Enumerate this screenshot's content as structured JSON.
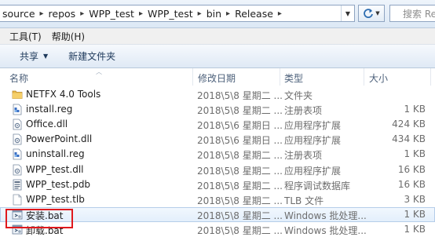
{
  "address": {
    "crumbs": [
      "source",
      "repos",
      "WPP_test",
      "WPP_test",
      "bin",
      "Release"
    ],
    "separator": "▸"
  },
  "search": {
    "placeholder": "搜索 Relea"
  },
  "menu": {
    "tools": "工具(T)",
    "help": "帮助(H)"
  },
  "toolbar": {
    "share": "共享",
    "new_folder": "新建文件夹"
  },
  "columns": {
    "name": "名称",
    "modified": "修改日期",
    "type": "类型",
    "size": "大小"
  },
  "files": [
    {
      "name": "NETFX 4.0 Tools",
      "date": "2018\\5\\8 星期二 ...",
      "type": "文件夹",
      "size": "",
      "icon": "folder-icon"
    },
    {
      "name": "install.reg",
      "date": "2018\\5\\8 星期二 ...",
      "type": "注册表项",
      "size": "1 KB",
      "icon": "registry-file-icon"
    },
    {
      "name": "Office.dll",
      "date": "2018\\5\\6 星期日 ...",
      "type": "应用程序扩展",
      "size": "424 KB",
      "icon": "dll-file-icon"
    },
    {
      "name": "PowerPoint.dll",
      "date": "2018\\5\\6 星期日 ...",
      "type": "应用程序扩展",
      "size": "434 KB",
      "icon": "dll-file-icon"
    },
    {
      "name": "uninstall.reg",
      "date": "2018\\5\\8 星期二 ...",
      "type": "注册表项",
      "size": "1 KB",
      "icon": "registry-file-icon"
    },
    {
      "name": "WPP_test.dll",
      "date": "2018\\5\\8 星期二 ...",
      "type": "应用程序扩展",
      "size": "16 KB",
      "icon": "dll-file-icon"
    },
    {
      "name": "WPP_test.pdb",
      "date": "2018\\5\\8 星期二 ...",
      "type": "程序调试数据库",
      "size": "16 KB",
      "icon": "pdb-file-icon"
    },
    {
      "name": "WPP_test.tlb",
      "date": "2018\\5\\8 星期二 ...",
      "type": "TLB 文件",
      "size": "3 KB",
      "icon": "blank-file-icon"
    },
    {
      "name": "安装.bat",
      "date": "2018\\5\\8 星期二 ...",
      "type": "Windows 批处理...",
      "size": "1 KB",
      "icon": "batch-file-icon",
      "selected": true
    },
    {
      "name": "卸载.bat",
      "date": "2018\\5\\8 星期二 ...",
      "type": "Windows 批处理...",
      "size": "1 KB",
      "icon": "batch-file-icon"
    }
  ],
  "colors": {
    "highlight": "#e0191d",
    "folder": "#e8b84a",
    "header_text": "#4c607a"
  }
}
